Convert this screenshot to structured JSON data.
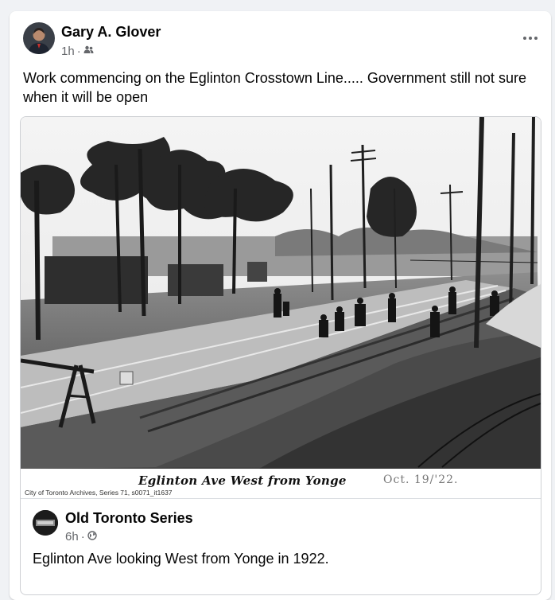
{
  "post": {
    "author": "Gary A. Glover",
    "time": "1h",
    "separator": "·",
    "audience_icon": "friends-icon",
    "text": "Work commencing on the Eglinton Crosstown Line..... Government still not sure when it will be open"
  },
  "shared": {
    "photo_caption": "Eglinton Ave West from Yonge",
    "photo_date": "Oct. 19/'22.",
    "archive_credit": "City of Toronto Archives, Series 71, s0071_it1637",
    "page_name": "Old Toronto Series",
    "time": "6h",
    "separator": "·",
    "audience_icon": "globe-icon",
    "text": "Eglinton Ave looking West from Yonge in 1922."
  },
  "colors": {
    "background": "#f0f2f5",
    "card": "#ffffff",
    "primary_text": "#050505",
    "secondary_text": "#65676b"
  }
}
